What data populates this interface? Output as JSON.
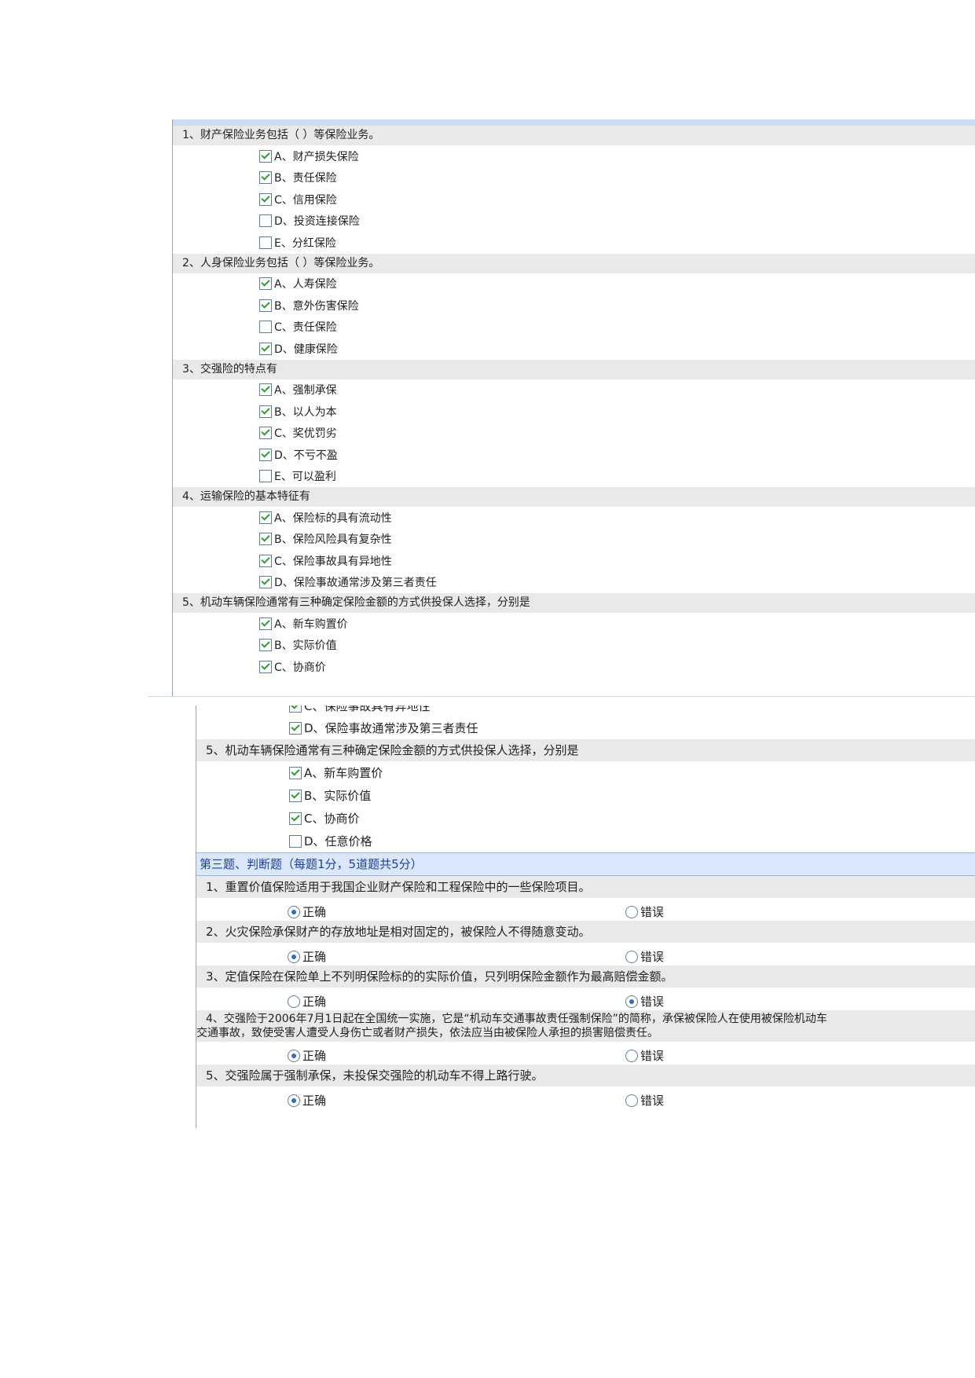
{
  "part1": {
    "questions": [
      {
        "num": "1、",
        "text": "财产保险业务包括（ ）等保险业务。",
        "options": [
          {
            "label": "A、财产损失保险",
            "checked": true
          },
          {
            "label": "B、责任保险",
            "checked": true
          },
          {
            "label": "C、信用保险",
            "checked": true
          },
          {
            "label": "D、投资连接保险",
            "checked": false
          },
          {
            "label": "E、分红保险",
            "checked": false
          }
        ]
      },
      {
        "num": "2、",
        "text": "人身保险业务包括（ ）等保险业务。",
        "options": [
          {
            "label": "A、人寿保险",
            "checked": true
          },
          {
            "label": "B、意外伤害保险",
            "checked": true
          },
          {
            "label": "C、责任保险",
            "checked": false
          },
          {
            "label": "D、健康保险",
            "checked": true
          }
        ]
      },
      {
        "num": "3、",
        "text": "交强险的特点有",
        "options": [
          {
            "label": "A、强制承保",
            "checked": true
          },
          {
            "label": "B、以人为本",
            "checked": true
          },
          {
            "label": "C、奖优罚劣",
            "checked": true
          },
          {
            "label": "D、不亏不盈",
            "checked": true
          },
          {
            "label": "E、可以盈利",
            "checked": false
          }
        ]
      },
      {
        "num": "4、",
        "text": "运输保险的基本特征有",
        "options": [
          {
            "label": "A、保险标的具有流动性",
            "checked": true
          },
          {
            "label": "B、保险风险具有复杂性",
            "checked": true
          },
          {
            "label": "C、保险事故具有异地性",
            "checked": true
          },
          {
            "label": "D、保险事故通常涉及第三者责任",
            "checked": true
          }
        ]
      },
      {
        "num": "5、",
        "text": "机动车辆保险通常有三种确定保险金额的方式供投保人选择，分别是",
        "options": [
          {
            "label": "A、新车购置价",
            "checked": true
          },
          {
            "label": "B、实际价值",
            "checked": true
          },
          {
            "label": "C、协商价",
            "checked": true
          }
        ]
      }
    ]
  },
  "part2": {
    "cut_option": "C、保险事故具有异地性",
    "q4_option_d": "D、保险事故通常涉及第三者责任",
    "q5_text": "5、机动车辆保险通常有三种确定保险金额的方式供投保人选择，分别是",
    "q5_options": [
      {
        "label": "A、新车购置价",
        "checked": true
      },
      {
        "label": "B、实际价值",
        "checked": true
      },
      {
        "label": "C、协商价",
        "checked": true
      },
      {
        "label": "D、任意价格",
        "checked": false
      }
    ],
    "section_title": "第三题、判断题（每题1分，5道题共5分）",
    "true_label": "正确",
    "false_label": "错误",
    "judgments": [
      {
        "text": "1、重置价值保险适用于我国企业财产保险和工程保险中的一些保险项目。",
        "answer": "true"
      },
      {
        "text": "2、火灾保险承保财产的存放地址是相对固定的，被保险人不得随意变动。",
        "answer": "true"
      },
      {
        "text": "3、定值保险在保险单上不列明保险标的的实际价值，只列明保险金额作为最高赔偿金额。",
        "answer": "false"
      },
      {
        "text": "4、交强险于2006年7月1日起在全国统一实施，它是“机动车交通事故责任强制保险”的简称，承保被保险人在使用被保险机动车",
        "text2": "交通事故，致使受害人遭受人身伤亡或者财产损失，依法应当由被保险人承担的损害赔偿责任。",
        "answer": "true"
      },
      {
        "text": "5、交强险属于强制承保，未投保交强险的机动车不得上路行驶。",
        "answer": "true"
      }
    ]
  }
}
